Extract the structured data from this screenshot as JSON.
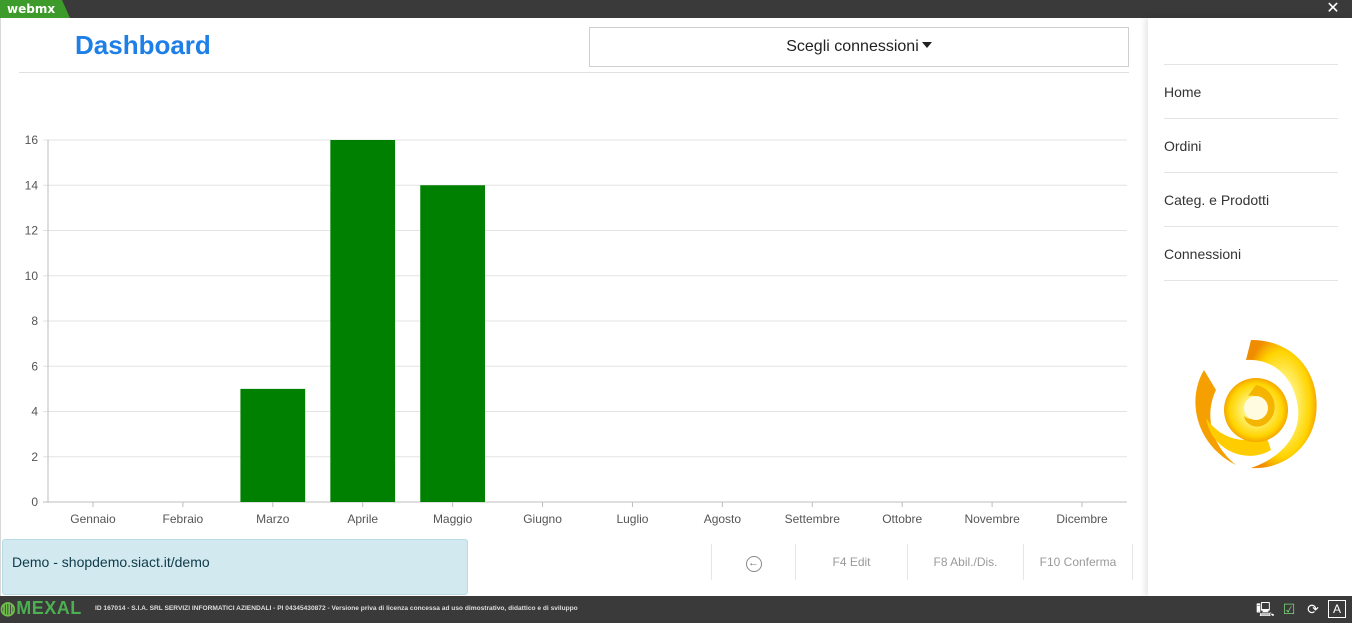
{
  "titlebar": {
    "app_name": "webmx",
    "close": "✕"
  },
  "header": {
    "title": "Dashboard",
    "connections_select": "Scegli connessioni"
  },
  "chart_data": {
    "type": "bar",
    "categories": [
      "Gennaio",
      "Febraio",
      "Marzo",
      "Aprile",
      "Maggio",
      "Giugno",
      "Luglio",
      "Agosto",
      "Settembre",
      "Ottobre",
      "Novembre",
      "Dicembre"
    ],
    "values": [
      0,
      0,
      5,
      16,
      14,
      0,
      0,
      0,
      0,
      0,
      0,
      0
    ],
    "ylim": [
      0,
      16
    ],
    "yticks": [
      0,
      2,
      4,
      6,
      8,
      10,
      12,
      14,
      16
    ],
    "grid": true,
    "bar_color": "#008000"
  },
  "status": {
    "connection_text": "Demo - shopdemo.siact.it/demo"
  },
  "fkeys": {
    "back": "←",
    "edit": "F4 Edit",
    "abil": "F8 Abil./Dis.",
    "confirm": "F10 Conferma"
  },
  "sidebar": {
    "items": [
      {
        "label": "Home"
      },
      {
        "label": "Ordini"
      },
      {
        "label": "Categ. e Prodotti"
      },
      {
        "label": "Connessioni"
      }
    ]
  },
  "bottombar": {
    "logo": "MEXAL",
    "license": "ID 167014 - S.I.A. SRL SERVIZI INFORMATICI AZIENDALI - PI 04345430872 - Versione priva di licenza concessa ad uso dimostrativo, didattico e di sviluppo",
    "tray": {
      "monitor_icon": "monitor-icon",
      "calendar_icon": "calendar-check-icon",
      "refresh_icon": "refresh-icon",
      "font_icon": "A"
    }
  },
  "colors": {
    "accent": "#1e7fe6",
    "bar": "#008000",
    "status_bg": "#d1e9ef",
    "topbar": "#3a3a3a",
    "tab_green": "#3c9b2a"
  }
}
